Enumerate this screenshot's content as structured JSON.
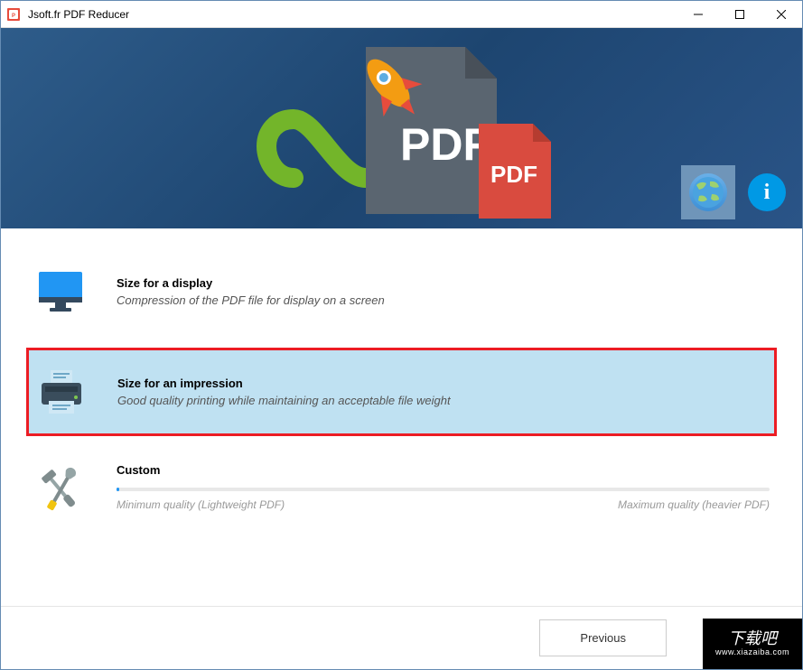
{
  "window": {
    "title": "Jsoft.fr PDF Reducer"
  },
  "banner": {
    "pdf_label_big": "PDF",
    "pdf_label_small": "PDF"
  },
  "options": {
    "display": {
      "title": "Size for a display",
      "desc": "Compression of the PDF file for display on a screen"
    },
    "impression": {
      "title": "Size for an impression",
      "desc": "Good quality printing while maintaining an acceptable file weight"
    },
    "custom": {
      "title": "Custom",
      "min_label": "Minimum quality (Lightweight PDF)",
      "max_label": "Maximum quality (heavier PDF)"
    }
  },
  "footer": {
    "previous": "Previous"
  },
  "watermark": {
    "text": "下载吧",
    "url": "www.xiazaiba.com"
  }
}
